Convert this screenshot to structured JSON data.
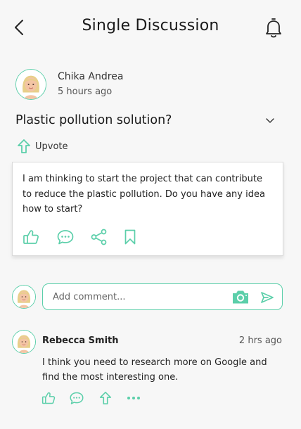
{
  "header": {
    "title": "Single Discussion"
  },
  "post": {
    "author": "Chika Andrea",
    "time": "5 hours ago",
    "title": "Plastic pollution solution?",
    "upvote_label": "Upvote",
    "body": "I am thinking to start the project that can contribute to reduce the plastic pollution. Do you have any idea how to start?"
  },
  "comment_input": {
    "placeholder": "Add comment..."
  },
  "reply": {
    "author": "Rebecca Smith",
    "time": "2 hrs ago",
    "body": "I think you need to research more on Google and find the most interesting one."
  },
  "colors": {
    "accent": "#5ccfaa",
    "background": "#f7f7f7"
  },
  "icons": [
    "back-arrow-icon",
    "bell-icon",
    "chevron-down-icon",
    "upvote-arrow-icon",
    "thumbs-up-icon",
    "comment-icon",
    "share-icon",
    "bookmark-icon",
    "camera-icon",
    "send-icon",
    "more-dots-icon"
  ]
}
